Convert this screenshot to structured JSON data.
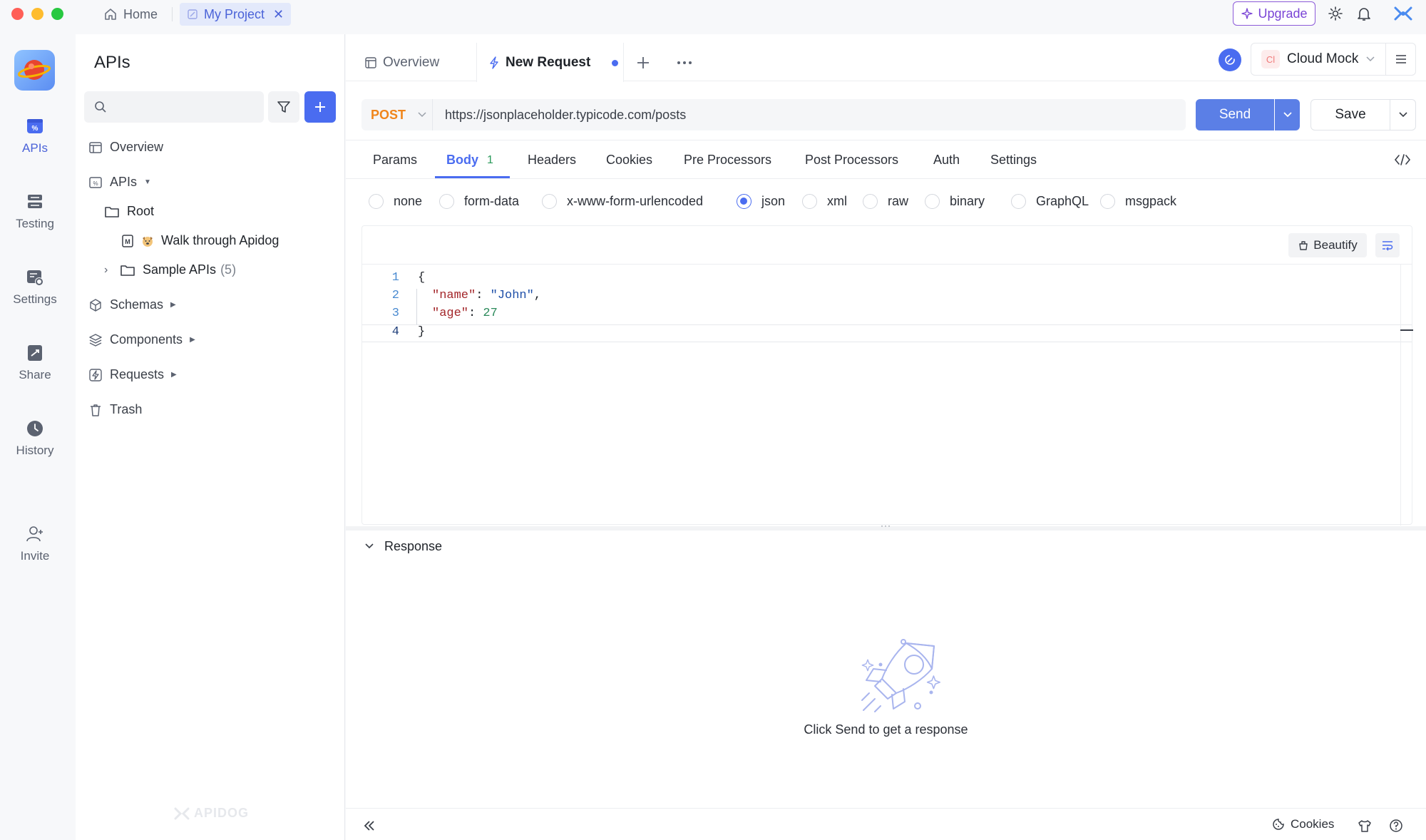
{
  "window": {
    "tabs": [
      {
        "label": "Home"
      },
      {
        "label": "My Project"
      }
    ],
    "upgrade_label": "Upgrade"
  },
  "rail": {
    "items": [
      {
        "label": "APIs"
      },
      {
        "label": "Testing"
      },
      {
        "label": "Settings"
      },
      {
        "label": "Share"
      },
      {
        "label": "History"
      },
      {
        "label": "Invite"
      }
    ]
  },
  "sidebar": {
    "title": "APIs",
    "search_placeholder": "",
    "tree": {
      "overview": "Overview",
      "apis": "APIs",
      "root": "Root",
      "walk": "Walk through Apidog",
      "sample": "Sample APIs",
      "sample_count": "(5)",
      "schemas": "Schemas",
      "components": "Components",
      "requests": "Requests",
      "trash": "Trash"
    },
    "watermark": "APIDOG"
  },
  "editor_tabs": {
    "overview": "Overview",
    "new_request": "New Request",
    "env_badge": "Cl",
    "env_name": "Cloud Mock"
  },
  "request": {
    "method": "POST",
    "url": "https://jsonplaceholder.typicode.com/posts",
    "send_label": "Send",
    "save_label": "Save"
  },
  "subtabs": {
    "params": "Params",
    "body": "Body",
    "body_count": "1",
    "headers": "Headers",
    "cookies": "Cookies",
    "pre": "Pre Processors",
    "post": "Post Processors",
    "auth": "Auth",
    "settings": "Settings"
  },
  "body_types": {
    "none": "none",
    "form_data": "form-data",
    "urlencoded": "x-www-form-urlencoded",
    "json": "json",
    "xml": "xml",
    "raw": "raw",
    "binary": "binary",
    "graphql": "GraphQL",
    "msgpack": "msgpack",
    "selected": "json"
  },
  "code": {
    "beautify_label": "Beautify",
    "lines": {
      "l1": {
        "n": "1",
        "open": "{"
      },
      "l2": {
        "n": "2",
        "key": "\"name\"",
        "colon": ": ",
        "value": "\"John\"",
        "comma": ","
      },
      "l3": {
        "n": "3",
        "key": "\"age\"",
        "colon": ": ",
        "value": "27"
      },
      "l4": {
        "n": "4",
        "close": "}"
      }
    }
  },
  "response": {
    "title": "Response",
    "empty_message": "Click Send to get a response"
  },
  "footer": {
    "cookies_label": "Cookies"
  },
  "colors": {
    "accent": "#4a6cf0",
    "method": "#f0851b",
    "upgrade": "#7a44d6"
  }
}
